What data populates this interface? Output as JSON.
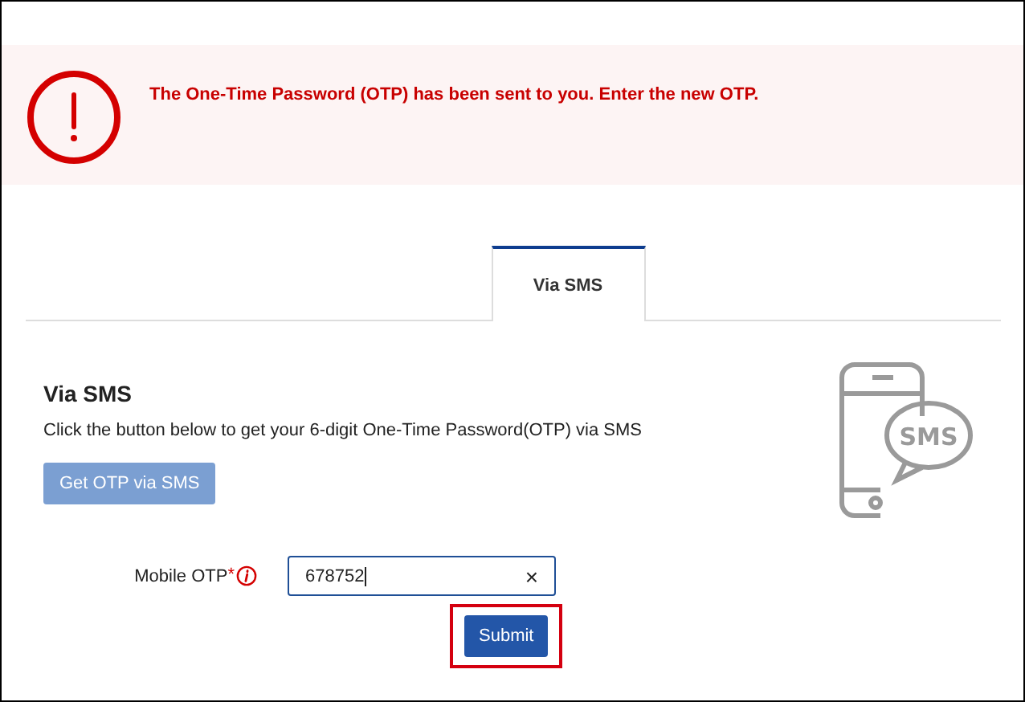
{
  "alert": {
    "message": "The One-Time Password (OTP) has been sent to you. Enter the new OTP."
  },
  "tabs": [
    {
      "label": "Via SMS",
      "selected": true
    }
  ],
  "section": {
    "heading": "Via SMS",
    "description": "Click the button below to get your 6-digit One-Time Password(OTP) via SMS",
    "request_button": "Get OTP via SMS",
    "icon_text": "SMS"
  },
  "otp_field": {
    "label": "Mobile OTP",
    "required_mark": "*",
    "value": "678752",
    "clear_symbol": "×"
  },
  "submit": {
    "label": "Submit",
    "highlighted": true
  }
}
